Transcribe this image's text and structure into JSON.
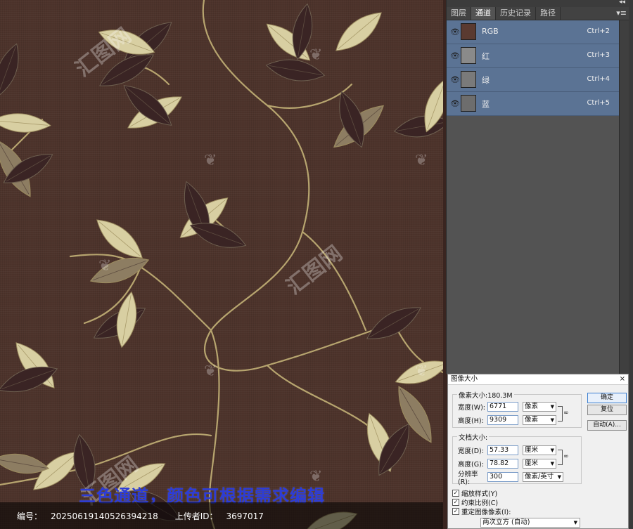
{
  "fabric": {
    "caption": "三色通道，颜色可根据需求编辑",
    "watermark_text": "汇图网",
    "info": {
      "id_label": "编号：",
      "id_value": "20250619140526394218",
      "uploader_label": "上传者ID：",
      "uploader_value": "3697017"
    },
    "colors": {
      "background": "#4d332b",
      "leaf_light": "#d8cfa2",
      "leaf_dark": "#3a2424",
      "leaf_mid": "#8d7d62",
      "stem": "#b7a56f"
    }
  },
  "channels_panel": {
    "collapse_icon": "double-chevron-icon",
    "tabs": [
      {
        "label": "图层",
        "active": false
      },
      {
        "label": "通道",
        "active": true
      },
      {
        "label": "历史记录",
        "active": false
      },
      {
        "label": "路径",
        "active": false
      }
    ],
    "channels": [
      {
        "name": "RGB",
        "shortcut": "Ctrl+2",
        "thumb_color": "#5a3a30"
      },
      {
        "name": "红",
        "shortcut": "Ctrl+3",
        "thumb_color": "#8a8a8a"
      },
      {
        "name": "绿",
        "shortcut": "Ctrl+4",
        "thumb_color": "#7a7a7a"
      },
      {
        "name": "蓝",
        "shortcut": "Ctrl+5",
        "thumb_color": "#6d6d6d"
      }
    ]
  },
  "image_size_dialog": {
    "title": "图像大小",
    "close": "×",
    "pixel_dimensions_label": "像素大小:180.3M",
    "pixel_width_label": "宽度(W):",
    "pixel_width_value": "6771",
    "pixel_width_unit": "像素",
    "pixel_height_label": "高度(H):",
    "pixel_height_value": "9309",
    "pixel_height_unit": "像素",
    "document_size_label": "文档大小:",
    "doc_width_label": "宽度(D):",
    "doc_width_value": "57.33",
    "doc_width_unit": "厘米",
    "doc_height_label": "高度(G):",
    "doc_height_value": "78.82",
    "doc_height_unit": "厘米",
    "resolution_label": "分辨率(R):",
    "resolution_value": "300",
    "resolution_unit": "像素/英寸",
    "ok_label": "确定",
    "reset_label": "复位",
    "auto_label": "自动(A)...",
    "scale_styles_label": "缩放样式(Y)",
    "constrain_label": "约束比例(C)",
    "resample_label": "重定图像像素(I):",
    "resample_value": "两次立方 (自动)"
  }
}
